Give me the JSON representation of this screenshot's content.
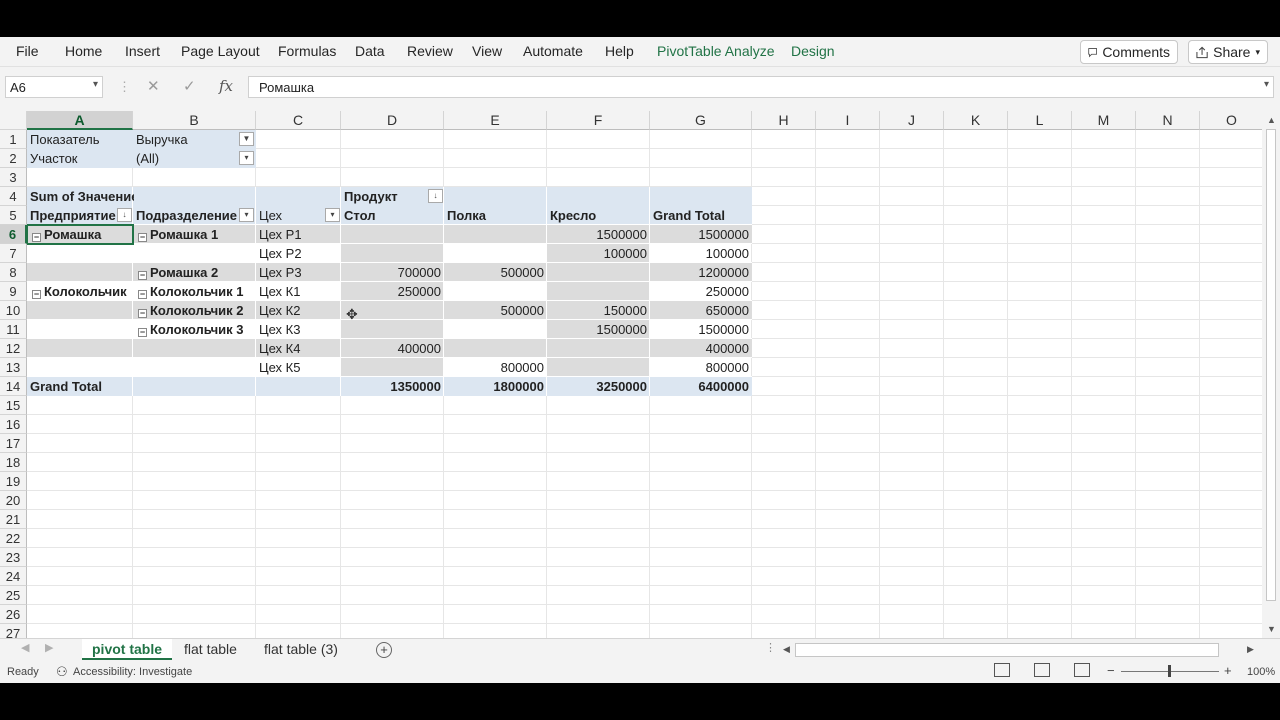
{
  "ribbon": {
    "tabs": [
      "File",
      "Home",
      "Insert",
      "Page Layout",
      "Formulas",
      "Data",
      "Review",
      "View",
      "Automate",
      "Help",
      "PivotTable Analyze",
      "Design"
    ],
    "comments_label": "Comments",
    "share_label": "Share"
  },
  "formula_bar": {
    "name_box": "A6",
    "cancel_icon": "✕",
    "enter_icon": "✓",
    "fx_label": "fx",
    "content": "Ромашка"
  },
  "columns": [
    "A",
    "B",
    "C",
    "D",
    "E",
    "F",
    "G",
    "H",
    "I",
    "J",
    "K",
    "L",
    "M",
    "N",
    "O"
  ],
  "selected_column": "A",
  "rows": [
    "1",
    "2",
    "3",
    "4",
    "5",
    "6",
    "7",
    "8",
    "9",
    "10",
    "11",
    "12",
    "13",
    "14",
    "15",
    "16",
    "17",
    "18",
    "19",
    "20",
    "21",
    "22",
    "23",
    "24",
    "25",
    "26",
    "27"
  ],
  "selected_row": "6",
  "pivot": {
    "filter_labels": [
      "Показатель",
      "Участок"
    ],
    "filter_values": [
      "Выручка",
      "(All)"
    ],
    "values_header": "Sum of Значение",
    "column_field": "Продукт",
    "row_fields": [
      "Предприятие",
      "Подразделение",
      "Цех"
    ],
    "column_items": [
      "Стол",
      "Полка",
      "Кресло",
      "Grand Total"
    ],
    "row_items": [
      {
        "level1": "Ромашка",
        "level2": "Ромашка 1",
        "level3": "Цех Р1",
        "values": [
          "",
          "",
          "1500000",
          "1500000"
        ]
      },
      {
        "level1": "",
        "level2": "",
        "level3": "Цех Р2",
        "values": [
          "",
          "",
          "100000",
          "100000"
        ]
      },
      {
        "level1": "",
        "level2": "Ромашка 2",
        "level3": "Цех Р3",
        "values": [
          "700000",
          "500000",
          "",
          "1200000"
        ]
      },
      {
        "level1": "Колокольчик",
        "level2": "Колокольчик 1",
        "level3": "Цех К1",
        "values": [
          "250000",
          "",
          "",
          "250000"
        ]
      },
      {
        "level1": "",
        "level2": "Колокольчик 2",
        "level3": "Цех К2",
        "values": [
          "",
          "500000",
          "150000",
          "650000"
        ]
      },
      {
        "level1": "",
        "level2": "Колокольчик 3",
        "level3": "Цех К3",
        "values": [
          "",
          "",
          "1500000",
          "1500000"
        ]
      },
      {
        "level1": "",
        "level2": "",
        "level3": "Цех К4",
        "values": [
          "400000",
          "",
          "",
          "400000"
        ]
      },
      {
        "level1": "",
        "level2": "",
        "level3": "Цех К5",
        "values": [
          "",
          "800000",
          "",
          "800000"
        ]
      }
    ],
    "grand_total_label": "Grand Total",
    "grand_total_values": [
      "1350000",
      "1800000",
      "3250000",
      "6400000"
    ]
  },
  "sheets": [
    "pivot table",
    "flat table",
    "flat table (3)"
  ],
  "active_sheet": "pivot table",
  "status": {
    "ready": "Ready",
    "accessibility": "Accessibility: Investigate",
    "zoom": "100%"
  }
}
